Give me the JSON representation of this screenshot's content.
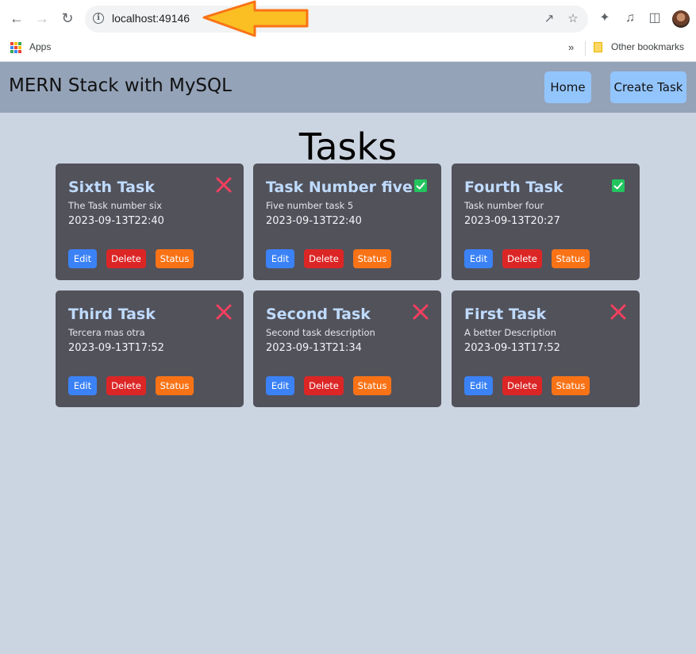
{
  "browser": {
    "url": "localhost:49146",
    "bookmarks": {
      "apps_label": "Apps",
      "other_label": "Other bookmarks"
    }
  },
  "navbar": {
    "brand": "MERN Stack with MySQL",
    "links": [
      {
        "label": "Home"
      },
      {
        "label": "Create Task"
      }
    ]
  },
  "page": {
    "title": "Tasks"
  },
  "colors": {
    "page_bg": "#cbd5e1",
    "navbar_bg": "#94a3b8",
    "card_bg": "#52525b",
    "title_text": "#bfdbfe",
    "done": "#22c55e",
    "not_done": "#f43f5e",
    "edit": "#3b82f6",
    "delete": "#dc2626",
    "status": "#f97316"
  },
  "buttons": {
    "edit": "Edit",
    "delete": "Delete",
    "status": "Status"
  },
  "tasks": [
    {
      "title": "Sixth Task",
      "description": "The Task number six",
      "date": "2023-09-13T22:40",
      "done": false
    },
    {
      "title": "Task Number five",
      "description": "Five number task 5",
      "date": "2023-09-13T22:40",
      "done": true
    },
    {
      "title": "Fourth Task",
      "description": "Task number four",
      "date": "2023-09-13T20:27",
      "done": true
    },
    {
      "title": "Third Task",
      "description": "Tercera mas otra",
      "date": "2023-09-13T17:52",
      "done": false
    },
    {
      "title": "Second Task",
      "description": "Second task description",
      "date": "2023-09-13T21:34",
      "done": false
    },
    {
      "title": "First Task",
      "description": "A better Description",
      "date": "2023-09-13T17:52",
      "done": false
    }
  ]
}
